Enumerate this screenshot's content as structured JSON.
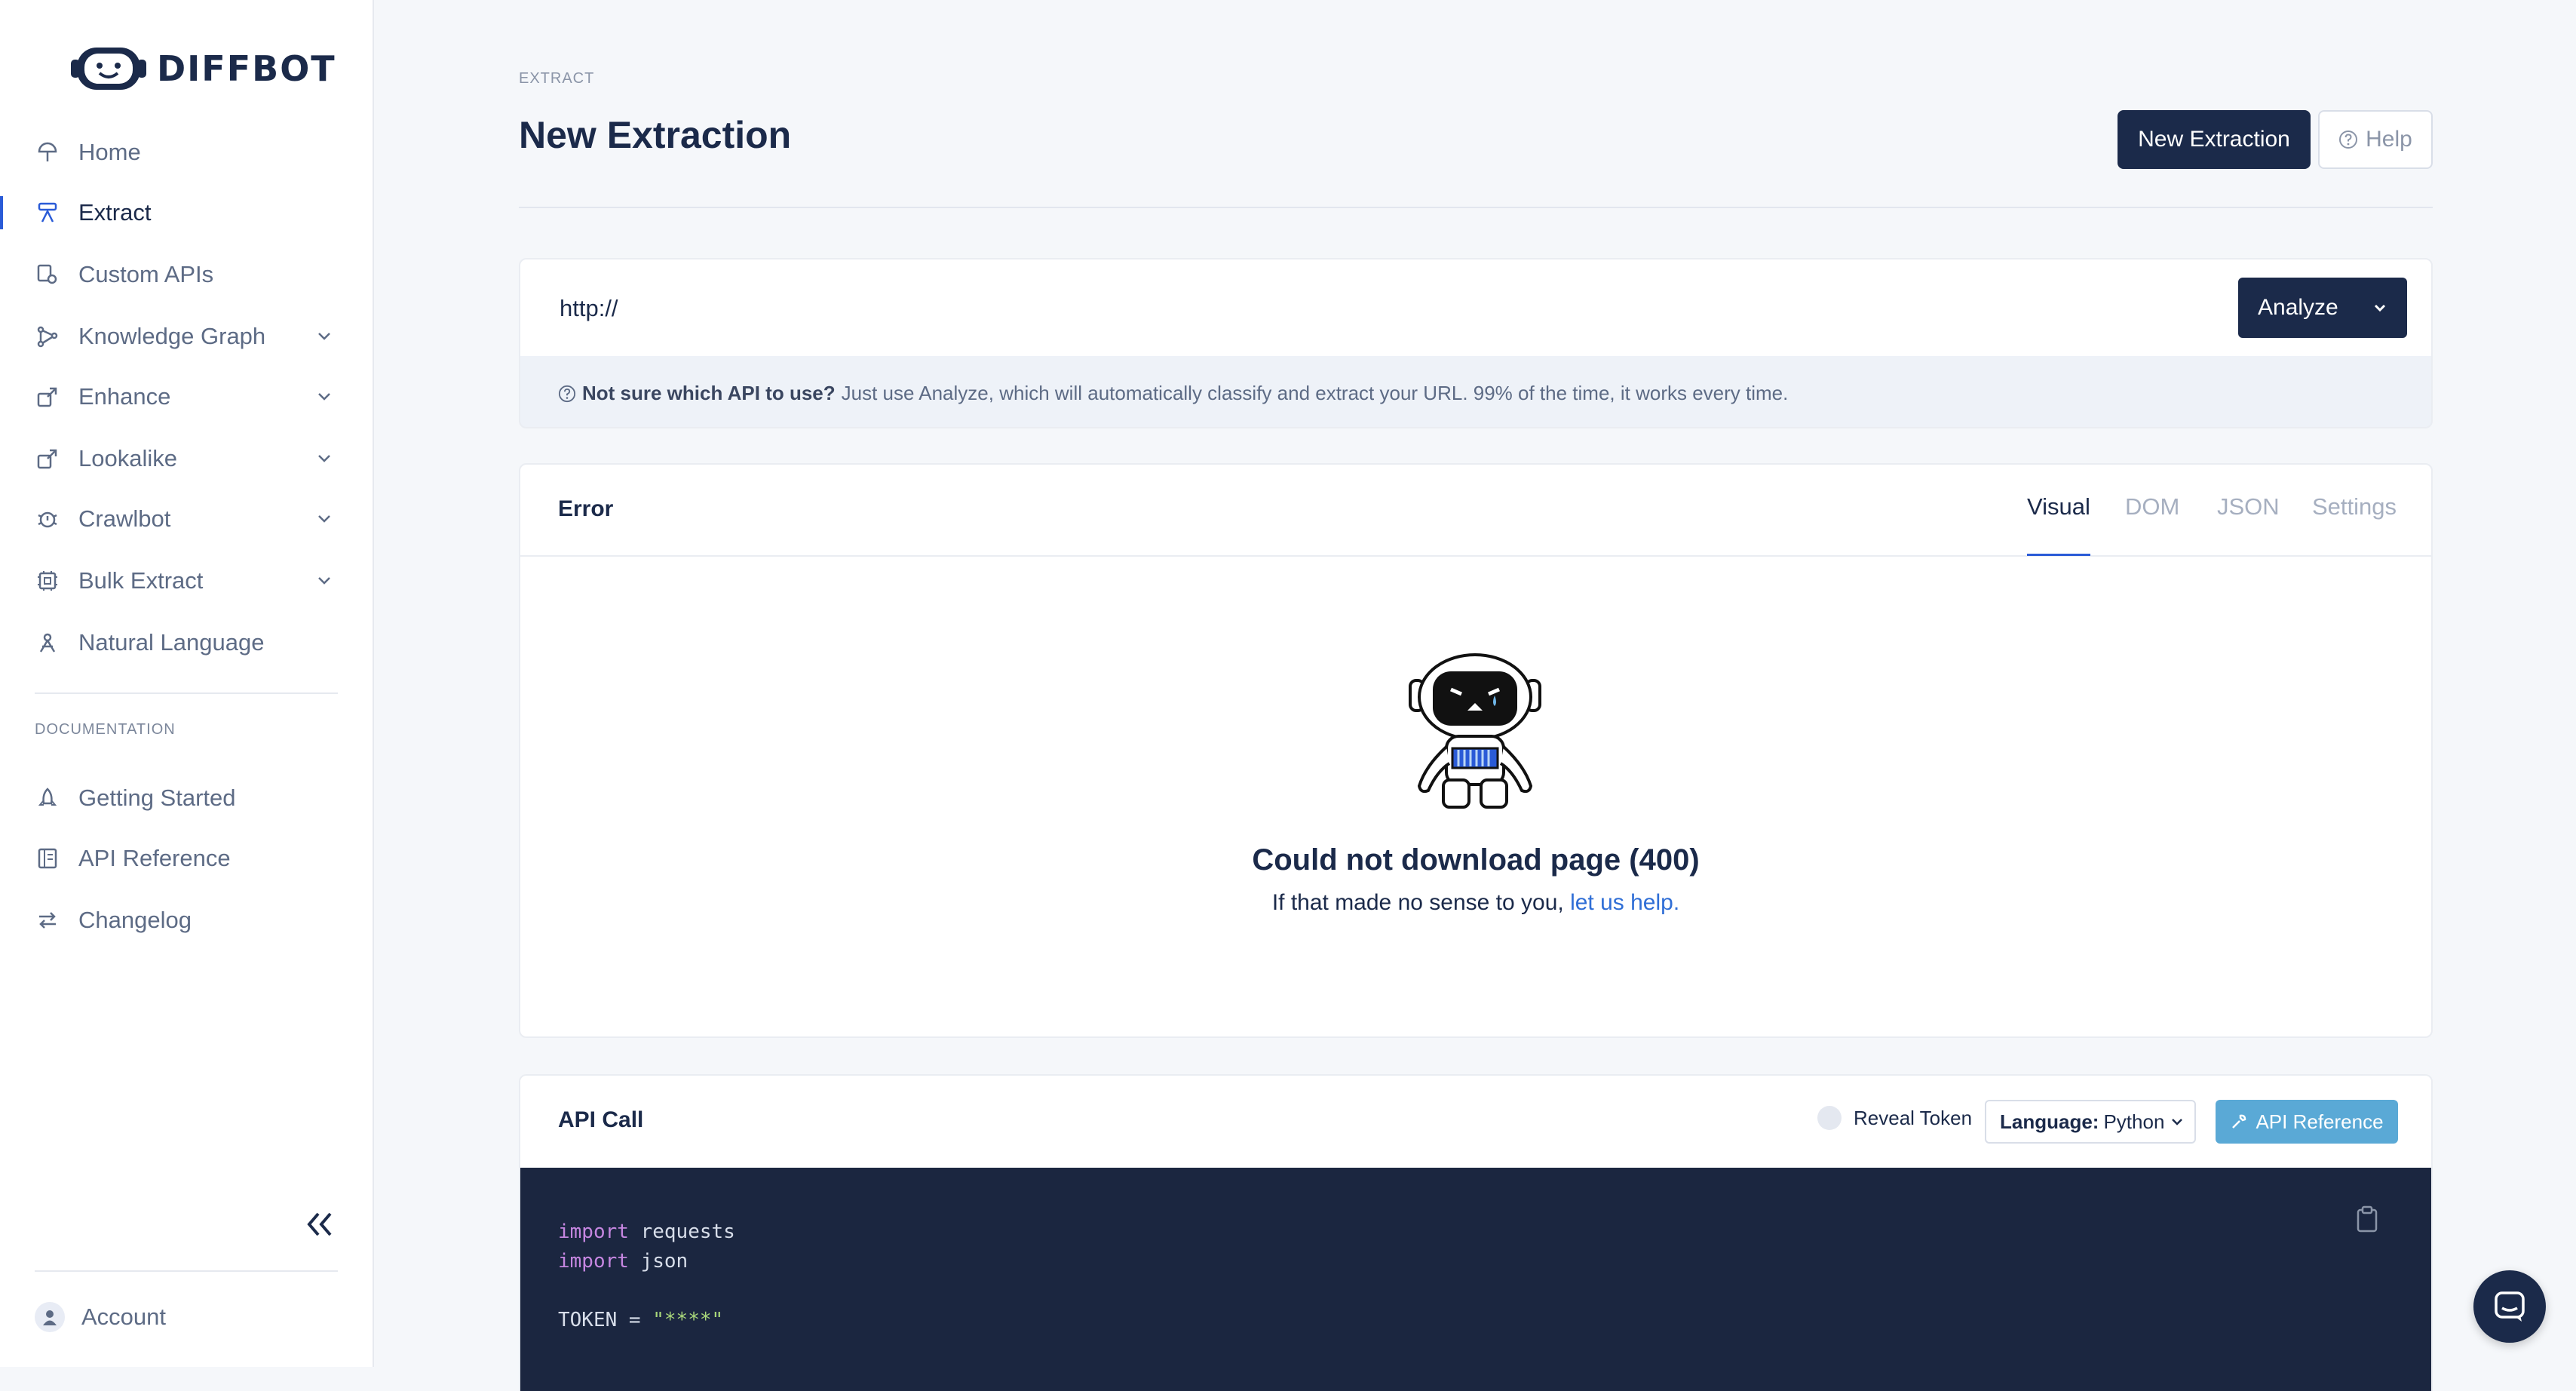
{
  "brand": {
    "name": "DIFFBOT"
  },
  "sidebar": {
    "items": [
      {
        "label": "Home",
        "icon": "home-icon"
      },
      {
        "label": "Extract",
        "icon": "extract-icon",
        "active": true
      },
      {
        "label": "Custom APIs",
        "icon": "custom-api-icon"
      },
      {
        "label": "Knowledge Graph",
        "icon": "graph-icon",
        "expandable": true
      },
      {
        "label": "Enhance",
        "icon": "enhance-icon",
        "expandable": true
      },
      {
        "label": "Lookalike",
        "icon": "lookalike-icon",
        "expandable": true
      },
      {
        "label": "Crawlbot",
        "icon": "crawlbot-icon",
        "expandable": true
      },
      {
        "label": "Bulk Extract",
        "icon": "bulk-icon",
        "expandable": true
      },
      {
        "label": "Natural Language",
        "icon": "language-icon"
      }
    ],
    "docs_label": "DOCUMENTATION",
    "docs": [
      {
        "label": "Getting Started",
        "icon": "rocket-icon"
      },
      {
        "label": "API Reference",
        "icon": "book-icon"
      },
      {
        "label": "Changelog",
        "icon": "swap-icon"
      }
    ],
    "account_label": "Account"
  },
  "header": {
    "breadcrumb": "EXTRACT",
    "title": "New Extraction",
    "new_button": "New Extraction",
    "help_button": "Help"
  },
  "url_bar": {
    "value": "http://",
    "analyze_label": "Analyze",
    "hint_bold": "Not sure which API to use?",
    "hint_text": "Just use Analyze, which will automatically classify and extract your URL. 99% of the time, it works every time."
  },
  "result": {
    "title": "Error",
    "tabs": [
      "Visual",
      "DOM",
      "JSON",
      "Settings"
    ],
    "active_tab": "Visual",
    "error_title": "Could not download page (400)",
    "error_sub": "If that made no sense to you,",
    "error_link": "let us help."
  },
  "api_call": {
    "title": "API Call",
    "reveal_label": "Reveal Token",
    "language_label": "Language:",
    "language_value": "Python",
    "reference_button": "API Reference",
    "code": {
      "line1_kw": "import",
      "line1_rest": " requests",
      "line2_kw": "import",
      "line2_rest": " json",
      "line3_name": "TOKEN = ",
      "line3_str": "\"****\""
    }
  },
  "colors": {
    "brand_navy": "#1b2a4a",
    "accent_blue": "#2a5bd7",
    "link_blue": "#2f6ed6",
    "api_button": "#5aa9d6"
  }
}
